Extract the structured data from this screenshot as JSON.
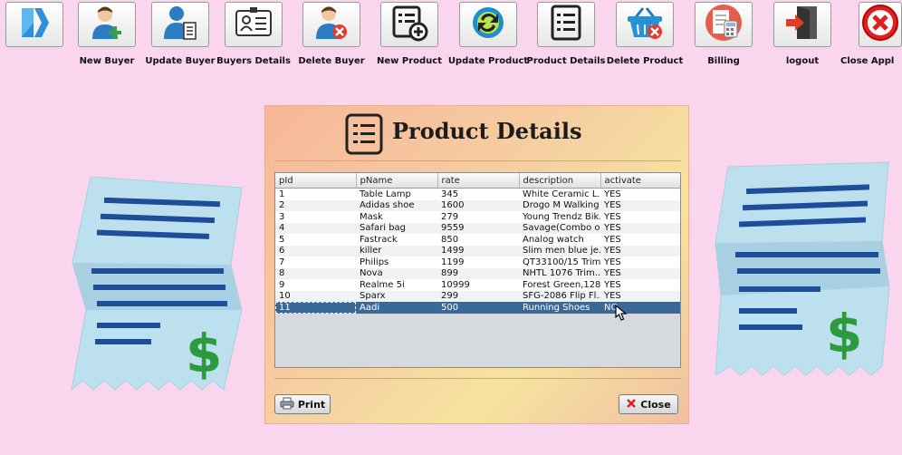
{
  "toolbar": {
    "items": [
      {
        "label": "",
        "icon": "sidebar-toggle-icon"
      },
      {
        "label": "New Buyer",
        "icon": "add-user-icon"
      },
      {
        "label": "Update Buyer",
        "icon": "update-user-icon"
      },
      {
        "label": "Buyers Details",
        "icon": "id-card-icon"
      },
      {
        "label": "Delete Buyer",
        "icon": "delete-user-icon"
      },
      {
        "label": "New Product",
        "icon": "add-list-icon"
      },
      {
        "label": "Update Product",
        "icon": "refresh-icon"
      },
      {
        "label": "Product Details",
        "icon": "list-icon"
      },
      {
        "label": "Delete Product",
        "icon": "delete-basket-icon"
      },
      {
        "label": "Billing",
        "icon": "billing-icon"
      },
      {
        "label": "logout",
        "icon": "logout-door-icon"
      },
      {
        "label": "Close Appl",
        "icon": "close-icon"
      }
    ]
  },
  "panel": {
    "title": "Product Details",
    "title_icon": "list-icon"
  },
  "table": {
    "columns": [
      "pId",
      "pName",
      "rate",
      "description",
      "activate"
    ],
    "rows": [
      [
        "1",
        "Table Lamp",
        "345",
        "White Ceramic L...",
        "YES"
      ],
      [
        "2",
        "Adidas shoe",
        "1600",
        "Drogo M Walking ...",
        "YES"
      ],
      [
        "3",
        "Mask",
        "279",
        "Young Trendz Bik...",
        "YES"
      ],
      [
        "4",
        "Safari bag",
        "9559",
        "Savage(Combo o...",
        "YES"
      ],
      [
        "5",
        "Fastrack",
        "850",
        "Analog watch",
        "YES"
      ],
      [
        "6",
        "killer",
        "1499",
        "Slim men blue je...",
        "YES"
      ],
      [
        "7",
        "Philips",
        "1199",
        "QT33100/15 Trim...",
        "YES"
      ],
      [
        "8",
        "Nova",
        "899",
        "NHTL 1076 Trim...",
        "YES"
      ],
      [
        "9",
        "Realme 5i",
        "10999",
        "Forest Green,128...",
        "YES"
      ],
      [
        "10",
        "Sparx",
        "299",
        "SFG-2086 Flip Fl...",
        "YES"
      ],
      [
        "11",
        "Aadi",
        "500",
        "Running Shoes",
        "NO"
      ]
    ],
    "selected_row": 10
  },
  "buttons": {
    "print_label": "Print",
    "close_label": "Close"
  },
  "colors": {
    "background": "#f9d6ee",
    "selection": "#3b6997",
    "receipt": "#bfe0ee",
    "receipt_lines": "#1e4e9a",
    "dollar": "#2e9a3e"
  }
}
